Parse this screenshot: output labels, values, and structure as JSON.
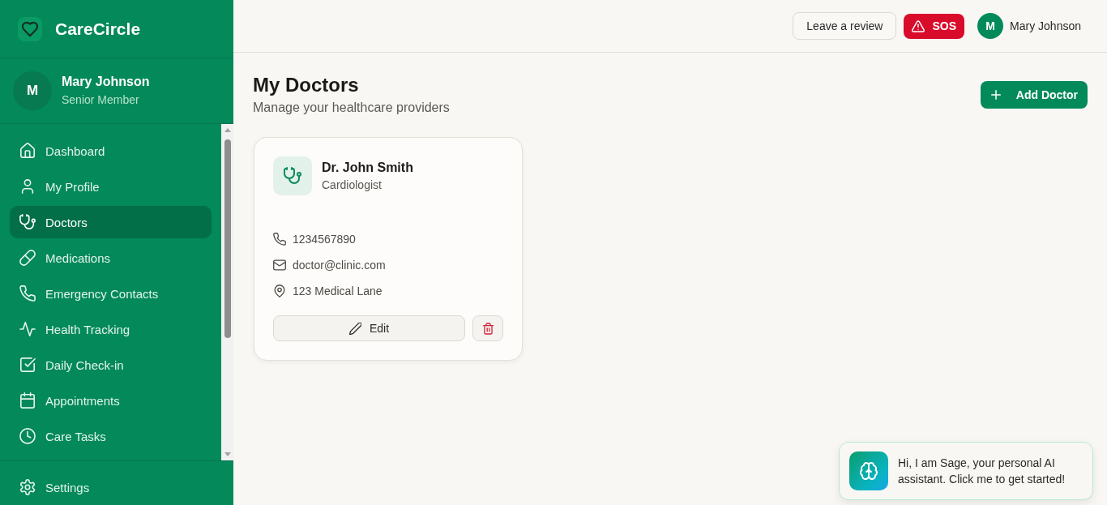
{
  "sidebar": {
    "brand": "CareCircle",
    "user": {
      "initial": "M",
      "name": "Mary Johnson",
      "role": "Senior Member"
    },
    "nav_items": [
      {
        "label": "Dashboard",
        "selected": false
      },
      {
        "label": "My Profile",
        "selected": false
      },
      {
        "label": "Doctors",
        "selected": true
      },
      {
        "label": "Medications",
        "selected": false
      },
      {
        "label": "Emergency Contacts",
        "selected": false
      },
      {
        "label": "Health Tracking",
        "selected": false
      },
      {
        "label": "Daily Check-in",
        "selected": false
      },
      {
        "label": "Appointments",
        "selected": false
      },
      {
        "label": "Care Tasks",
        "selected": false
      }
    ],
    "footer_item": {
      "label": "Settings"
    }
  },
  "top_bar": {
    "review_button": "Leave a review",
    "sos_button": "SOS",
    "user": {
      "initial": "M",
      "name": "Mary Johnson"
    }
  },
  "page": {
    "title": "My Doctors",
    "subtitle": "Manage your healthcare providers",
    "add_button": "Add Doctor"
  },
  "doctors": [
    {
      "name": "Dr. John Smith",
      "specialty": "Cardiologist",
      "phone": "1234567890",
      "email": "doctor@clinic.com",
      "address": "123 Medical Lane",
      "edit_button": "Edit"
    }
  ],
  "assistant": {
    "message": "Hi, I am Sage, your personal AI assistant. Click me to get started!"
  }
}
